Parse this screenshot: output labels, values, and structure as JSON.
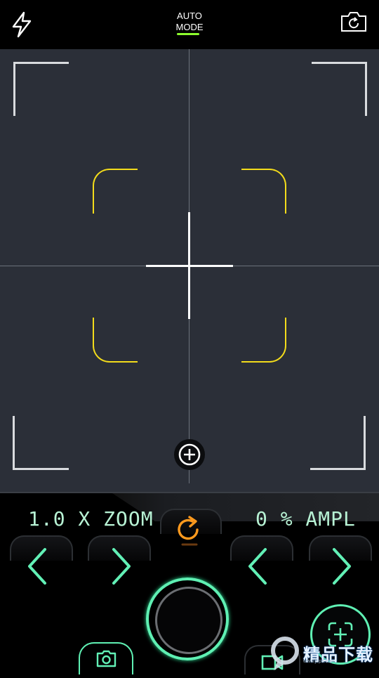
{
  "topbar": {
    "flash_icon": "lightning-bolt-icon",
    "mode_line1": "AUTO",
    "mode_line2": "MODE",
    "mode_underline_color": "#8dff2e",
    "switch_camera_icon": "camera-switch-icon"
  },
  "viewfinder": {
    "background": "#2b2f38",
    "frame_color": "#d9dbde",
    "focus_bracket_color": "#f3dc1b",
    "focus_button_icon": "plus-circle-icon"
  },
  "controls": {
    "zoom_readout": "1.0 X ZOOM",
    "ampl_readout": "0 % AMPL",
    "accent_color": "#5ff0b3",
    "reset_icon": "rotate-icon",
    "zoom_decrease_icon": "chevron-left-icon",
    "zoom_increase_icon": "chevron-right-icon",
    "ampl_decrease_icon": "chevron-left-icon",
    "ampl_increase_icon": "chevron-right-icon",
    "shutter_icon": "shutter-ring-icon",
    "photo_mode_icon": "camera-icon",
    "video_mode_icon": "video-camera-icon",
    "add_focus_icon": "focus-plus-icon"
  },
  "watermark": {
    "text": "精品下载",
    "url": "www.jbpc.com"
  }
}
